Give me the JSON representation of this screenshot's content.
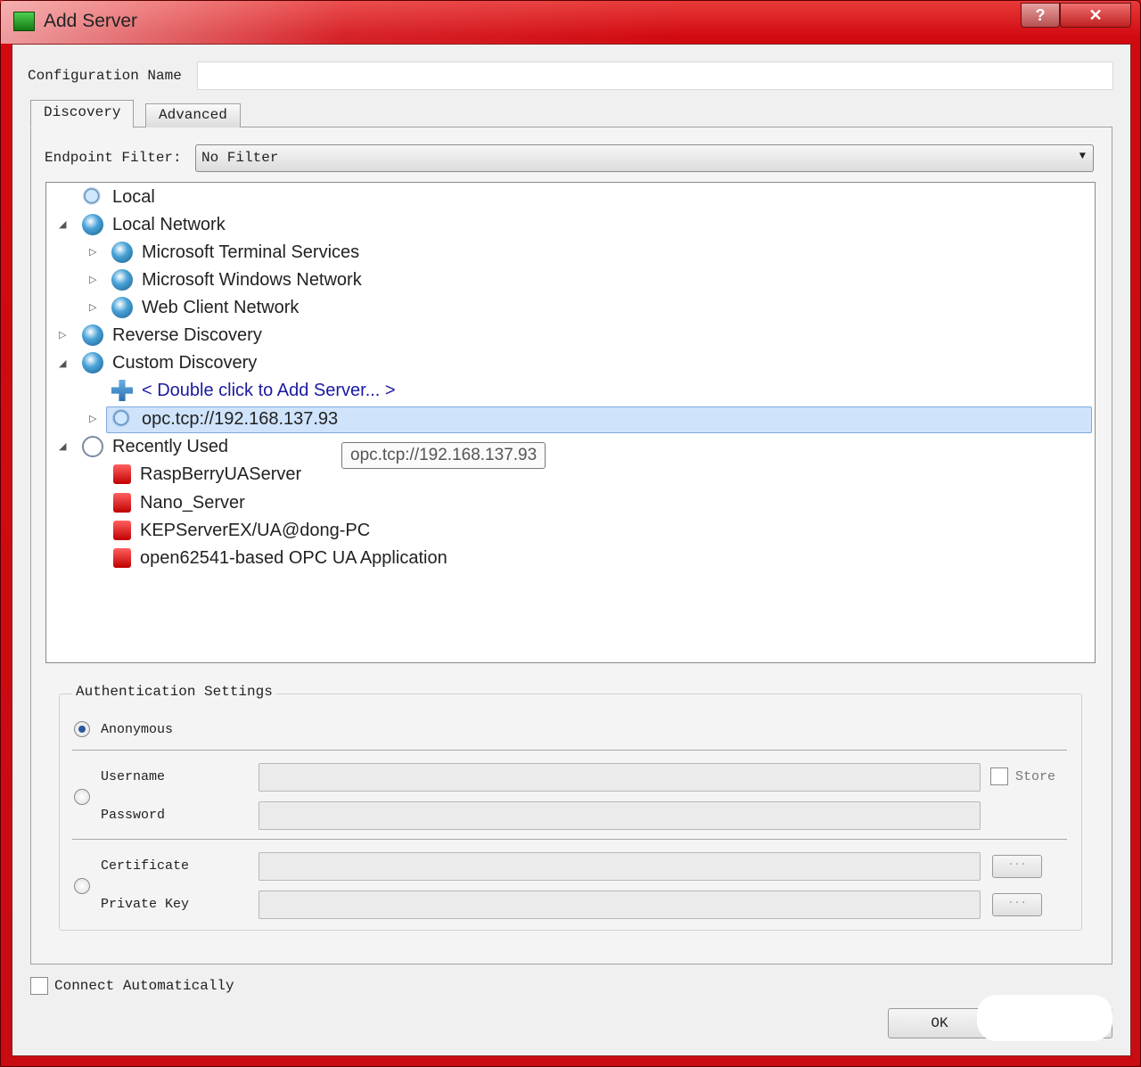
{
  "window": {
    "title": "Add Server",
    "help_label": "?",
    "close_label": "✕"
  },
  "config": {
    "label": "Configuration Name",
    "value": ""
  },
  "tabs": [
    {
      "label": "Discovery",
      "active": true
    },
    {
      "label": "Advanced",
      "active": false
    }
  ],
  "filter": {
    "label": "Endpoint Filter:",
    "value": "No Filter"
  },
  "tree": [
    {
      "label": "Local",
      "icon": "magnifier-icon"
    },
    {
      "label": "Local Network",
      "icon": "globe-icon",
      "expanded": true
    },
    {
      "label": "Microsoft Terminal Services",
      "icon": "network-icon"
    },
    {
      "label": "Microsoft Windows Network",
      "icon": "network-icon"
    },
    {
      "label": "Web Client Network",
      "icon": "network-icon"
    },
    {
      "label": "Reverse Discovery",
      "icon": "globe-icon"
    },
    {
      "label": "Custom Discovery",
      "icon": "globe-icon",
      "expanded": true
    },
    {
      "label": "< Double click to Add Server... >",
      "icon": "plus-icon"
    },
    {
      "label": "opc.tcp://192.168.137.93",
      "icon": "magnifier-icon",
      "selected": true
    },
    {
      "label": "Recently Used",
      "icon": "clock-icon",
      "expanded": true
    },
    {
      "label": "RaspBerryUAServer",
      "icon": "lock-icon"
    },
    {
      "label": "Nano_Server",
      "icon": "lock-icon"
    },
    {
      "label": "KEPServerEX/UA@dong-PC",
      "icon": "lock-icon"
    },
    {
      "label": "open62541-based OPC UA Application",
      "icon": "lock-icon"
    }
  ],
  "tooltip": "opc.tcp://192.168.137.93",
  "auth": {
    "title": "Authentication Settings",
    "anonymous": "Anonymous",
    "username": "Username",
    "password": "Password",
    "store": "Store",
    "certificate": "Certificate",
    "private_key": "Private Key",
    "browse": "..."
  },
  "connect_auto": "Connect Automatically",
  "ok": "OK",
  "colors": {
    "title_bar": "#d10a10",
    "selection": "#cfe3fb",
    "link": "#1a1aa0"
  }
}
